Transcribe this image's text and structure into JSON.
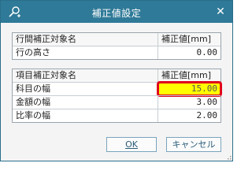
{
  "window": {
    "title": "補正値設定",
    "close_glyph": "✕",
    "title_icon": "search-plus-icon",
    "titlebar_color": "#2f7a98"
  },
  "row_table": {
    "header": {
      "name": "行間補正対象名",
      "value": "補正値[mm]"
    },
    "rows": [
      {
        "name": "行の高さ",
        "value": "0.00"
      }
    ]
  },
  "item_table": {
    "header": {
      "name": "項目補正対象名",
      "value": "補正値[mm]"
    },
    "rows": [
      {
        "name": "科目の幅",
        "value": "15.00",
        "highlight": "#ffff00",
        "outline": "#e0001b"
      },
      {
        "name": "金額の幅",
        "value": "3.00"
      },
      {
        "name": "比率の幅",
        "value": "2.00"
      }
    ]
  },
  "buttons": {
    "ok_label": "OK",
    "cancel_label": "キャンセル"
  }
}
